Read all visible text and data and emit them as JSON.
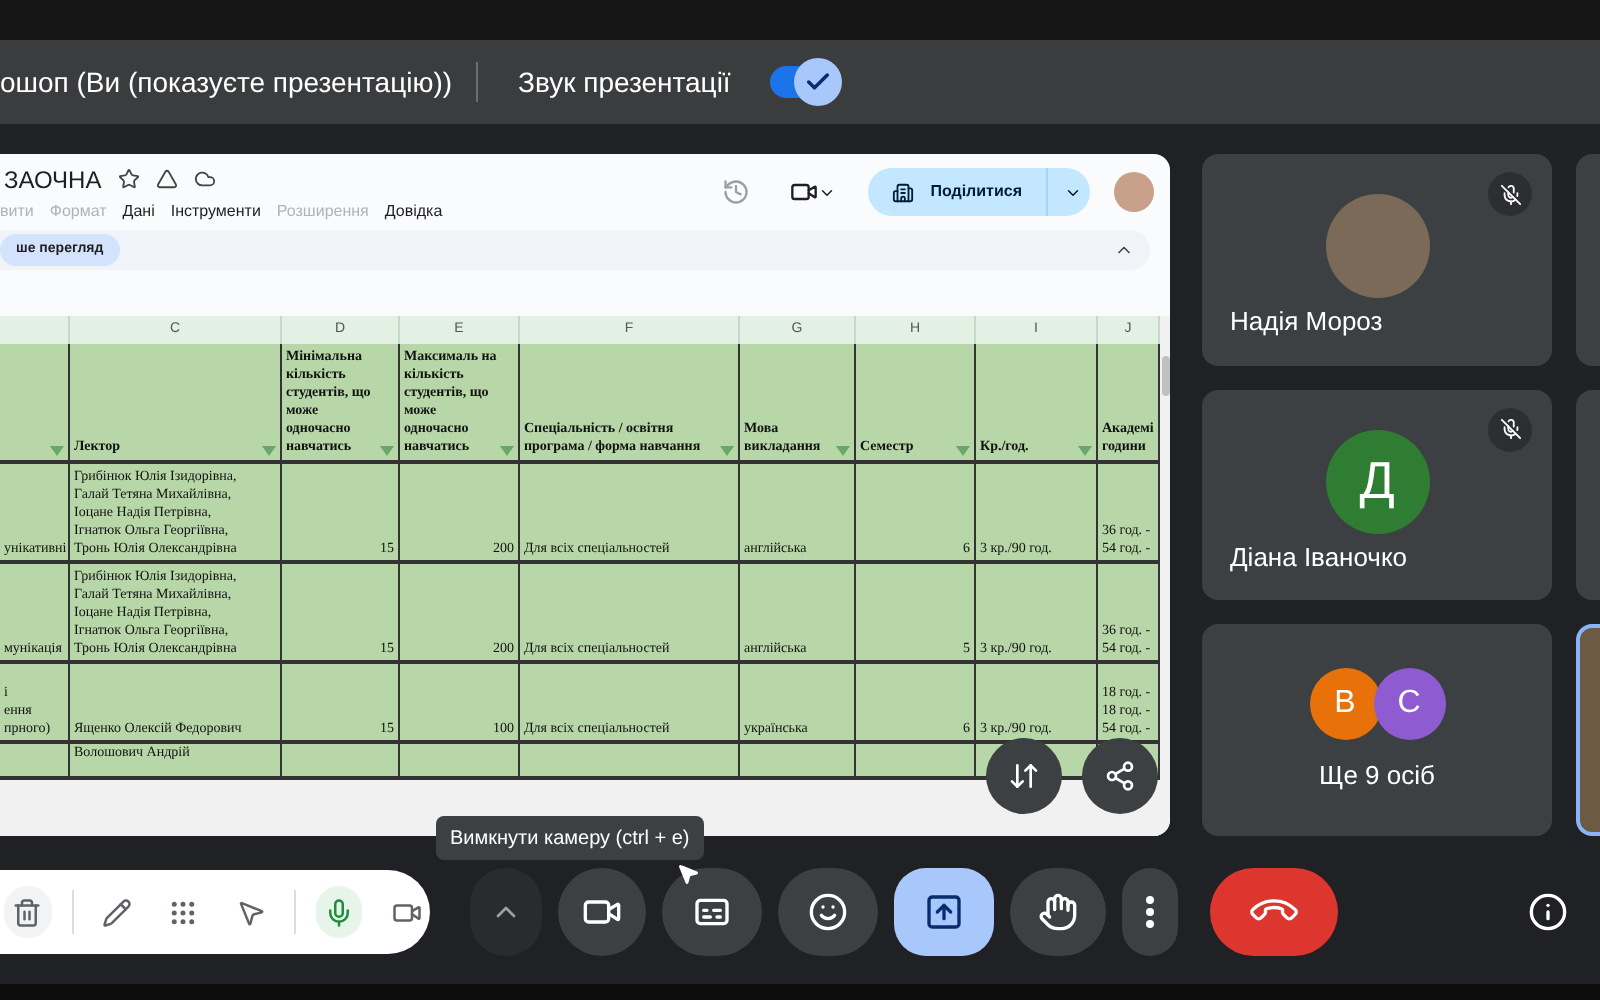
{
  "presenting_bar": {
    "title": "ошоп (Ви (показуєте презентацію))",
    "audio_label": "Звук презентації",
    "audio_on": true
  },
  "sheet": {
    "title": "ЗАОЧНА",
    "menu": [
      {
        "label": "вити",
        "disabled": true
      },
      {
        "label": "Формат",
        "disabled": true
      },
      {
        "label": "Дані",
        "disabled": false
      },
      {
        "label": "Інструменти",
        "disabled": false
      },
      {
        "label": "Розширення",
        "disabled": true
      },
      {
        "label": "Довідка",
        "disabled": false
      }
    ],
    "share_button": "Поділитися",
    "chip": "ше перегляд",
    "column_letters": [
      "C",
      "D",
      "E",
      "F",
      "G",
      "H",
      "I",
      "J"
    ],
    "header": {
      "lecturer": "Лектор",
      "min_students": "Мінімальна кількість студентів, що може одночасно навчатись",
      "max_students": "Максималь на кількість студентів, що може одночасно навчатись",
      "specialty": "Спеціальність / освітня програма / форма навчання",
      "language": "Мова викладання",
      "semester": "Семестр",
      "credits": "Кр./год.",
      "hours": "Академі\nгодини"
    },
    "rows": [
      {
        "column_b": "унікативні",
        "lecturer": "Грибінюк Юлія Ізидорівна,\nГалай Тетяна Михайлівна,\nІоцане Надія Петрівна,\nІгнатюк Ольга Георгіївна,\nТронь Юлія Олександрівна",
        "min_students": "15",
        "max_students": "200",
        "specialty": "Для всіх спеціальностей",
        "language": "англійська",
        "semester": "6",
        "credits": "3 кр./90 год.",
        "hours": "36 год. -\n54 год. -"
      },
      {
        "column_b": "мунікація",
        "lecturer": "Грибінюк Юлія Ізидорівна,\nГалай Тетяна Михайлівна,\nІоцане Надія Петрівна,\nІгнатюк Ольга Георгіївна,\nТронь Юлія Олександрівна",
        "min_students": "15",
        "max_students": "200",
        "specialty": "Для всіх спеціальностей",
        "language": "англійська",
        "semester": "5",
        "credits": "3 кр./90 год.",
        "hours": "36 год. -\n54 год. -"
      },
      {
        "column_b": "і\nення\nпрного)",
        "lecturer": "Ященко Олексій Федорович",
        "min_students": "15",
        "max_students": "100",
        "specialty": "Для всіх спеціальностей",
        "language": "українська",
        "semester": "6",
        "credits": "3 кр./90 год.",
        "hours": "18 год. -\n18 год. -\n54 год. -"
      },
      {
        "lecturer": "Волошович Андрій"
      }
    ]
  },
  "participants": [
    {
      "kind": "photo",
      "name": "Надія Мороз",
      "muted": true
    },
    {
      "kind": "initial",
      "name": "Діана Іваночко",
      "initial": "Д",
      "color": "#2e7d32",
      "muted": true
    },
    {
      "kind": "more",
      "name": "Ще 9 осіб",
      "avatars": [
        {
          "initial": "В",
          "color": "#e8710a"
        },
        {
          "initial": "С",
          "color": "#8e5cd0"
        }
      ],
      "muted": false
    }
  ],
  "tooltip": "Вимкнути камеру (ctrl + e)",
  "annotation_tools": [
    {
      "kind": "trash",
      "active": false
    },
    {
      "kind": "pen",
      "active": false
    },
    {
      "kind": "grid",
      "active": false
    },
    {
      "kind": "pointer",
      "active": false
    },
    {
      "kind": "mic",
      "active": true
    },
    {
      "kind": "video",
      "active": false
    }
  ],
  "controls": [
    {
      "kind": "caret",
      "selected": false
    },
    {
      "kind": "camera",
      "selected": false
    },
    {
      "kind": "captions",
      "selected": false
    },
    {
      "kind": "emoji",
      "selected": false
    },
    {
      "kind": "present",
      "selected": true
    },
    {
      "kind": "hand",
      "selected": false
    },
    {
      "kind": "more",
      "selected": false
    },
    {
      "kind": "end",
      "selected": false
    }
  ]
}
